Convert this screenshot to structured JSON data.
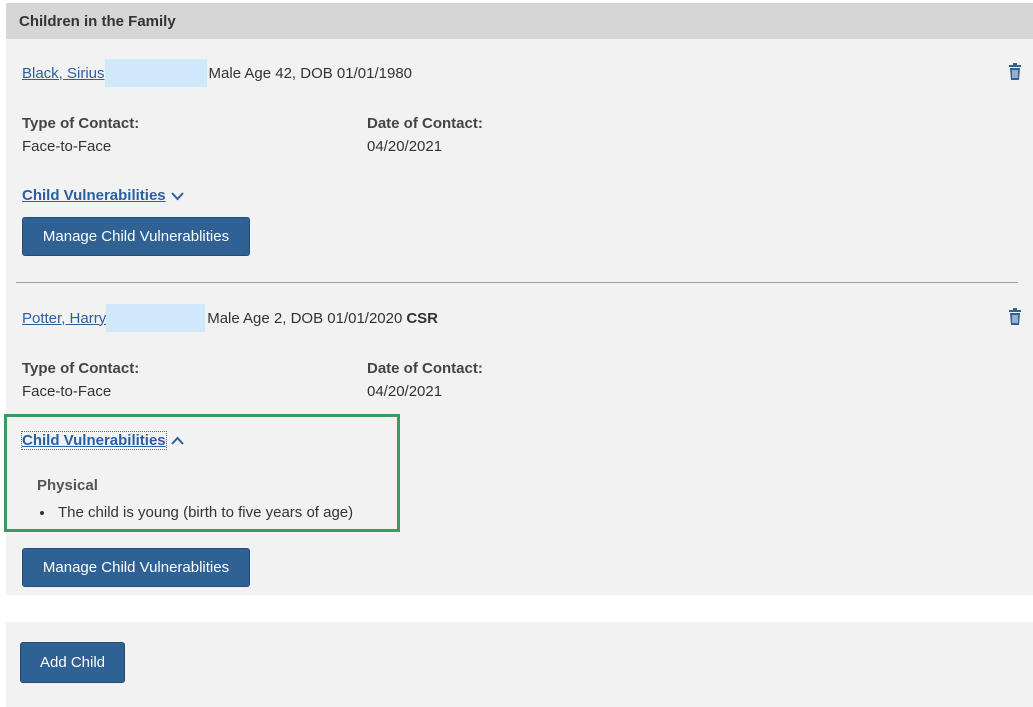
{
  "section": {
    "title": "Children in the Family"
  },
  "children": [
    {
      "name": "Black, Sirius",
      "info": "Male Age 42, DOB 01/01/1980",
      "csr": "",
      "type_label": "Type of Contact:",
      "type_value": "Face-to-Face",
      "date_label": "Date of Contact:",
      "date_value": "04/20/2021",
      "vuln_label": "Child Vulnerabilities",
      "vuln_expanded": false,
      "manage_label": "Manage Child Vulnerablities"
    },
    {
      "name": "Potter, Harry",
      "info": "Male Age 2, DOB 01/01/2020",
      "csr": "CSR",
      "type_label": "Type of Contact:",
      "type_value": "Face-to-Face",
      "date_label": "Date of Contact:",
      "date_value": "04/20/2021",
      "vuln_label": "Child Vulnerabilities",
      "vuln_expanded": true,
      "vuln_category": "Physical",
      "vuln_items": [
        "The child is young (birth to five years of age)"
      ],
      "manage_label": "Manage Child Vulnerablities"
    }
  ],
  "footer": {
    "add_child_label": "Add Child"
  },
  "icons": {
    "delete": "trash-icon",
    "collapsed": "chevron-down-icon",
    "expanded": "chevron-up-icon"
  },
  "colors": {
    "link": "#2c5fa0",
    "button": "#2f6194",
    "highlight": "#3a9a62",
    "panel": "#f2f2f2",
    "header": "#d6d6d6"
  }
}
